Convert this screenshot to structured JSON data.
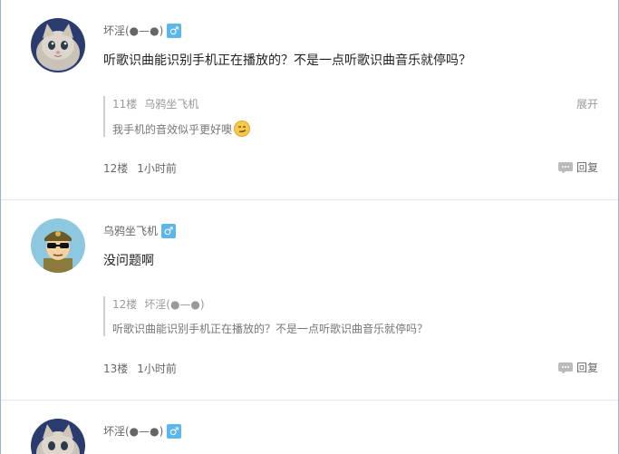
{
  "posts": [
    {
      "author": "坏淫(●—●)",
      "content": "听歌识曲能识别手机正在播放的？不是一点听歌识曲音乐就停吗？",
      "quote": {
        "floor": "11楼",
        "author": "乌鸦坐飞机",
        "text": "我手机的音效似乎更好噢",
        "expand": "展开"
      },
      "floor": "12楼",
      "time": "1小时前",
      "reply": "回复"
    },
    {
      "author": "乌鸦坐飞机",
      "content": "没问题啊",
      "quote": {
        "floor": "12楼",
        "author": "坏淫(●—●)",
        "text": "听歌识曲能识别手机正在播放的？不是一点听歌识曲音乐就停吗？"
      },
      "floor": "13楼",
      "time": "1小时前",
      "reply": "回复"
    },
    {
      "author": "坏淫(●—●)"
    }
  ],
  "gender_icon": "male-icon",
  "colors": {
    "gender_badge": "#5db6ea",
    "divider": "#e6e6e6",
    "frame": "#9ab2cf"
  }
}
